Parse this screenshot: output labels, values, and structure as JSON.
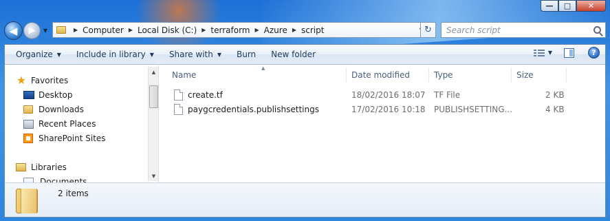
{
  "window": {
    "caption_buttons": {
      "minimize": "—",
      "maximize": "□",
      "close": "✕"
    }
  },
  "navigation": {
    "back_glyph": "◀",
    "forward_glyph": "▶",
    "history_glyph": "▼",
    "breadcrumb": [
      "Computer",
      "Local Disk (C:)",
      "terraform",
      "Azure",
      "script"
    ],
    "address_dropdown_glyph": "▼",
    "refresh_glyph": "↻",
    "search_placeholder": "Search script"
  },
  "toolbar": {
    "organize": "Organize",
    "include_in_library": "Include in library",
    "share_with": "Share with",
    "burn": "Burn",
    "new_folder": "New folder",
    "help_glyph": "?",
    "caret": "▼"
  },
  "nav_pane": {
    "favorites": "Favorites",
    "desktop": "Desktop",
    "downloads": "Downloads",
    "recent_places": "Recent Places",
    "sharepoint_sites": "SharePoint Sites",
    "libraries": "Libraries",
    "documents": "Documents",
    "scroll_up": "▲",
    "scroll_down": "▼"
  },
  "file_list": {
    "columns": {
      "name": "Name",
      "date_modified": "Date modified",
      "type": "Type",
      "size": "Size"
    },
    "sort_glyph": "▲",
    "rows": [
      {
        "name": "create.tf",
        "date": "18/02/2016 18:07",
        "type": "TF File",
        "size": "2 KB"
      },
      {
        "name": "paygcredentials.publishsettings",
        "date": "17/02/2016 10:18",
        "type": "PUBLISHSETTING...",
        "size": "4 KB"
      }
    ]
  },
  "details": {
    "item_count": "2 items"
  },
  "colors": {
    "accent": "#1e395b",
    "window_border": "#6b85a6",
    "desktop": "#2f86dd"
  }
}
